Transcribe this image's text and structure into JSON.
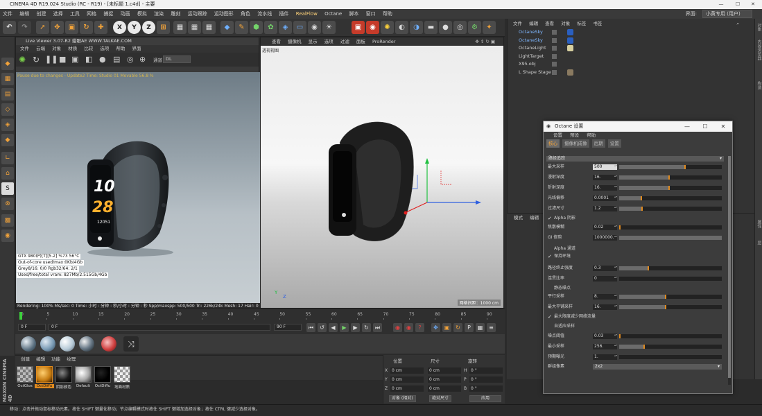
{
  "window": {
    "title": "CINEMA 4D R19.024 Studio (RC - R19) - [未标题 1.c4d] - 主要",
    "minimize": "—",
    "maximize": "☐",
    "close": "✕"
  },
  "menubar": {
    "items": [
      "文件",
      "编辑",
      "创建",
      "选择",
      "工具",
      "网格",
      "捕捉",
      "动画",
      "模拟",
      "渲染",
      "雕刻",
      "运动跟踪",
      "运动图形",
      "角色",
      "流水线",
      "插件",
      "RealFlow",
      "Octane",
      "脚本",
      "窗口",
      "帮助"
    ],
    "layout_label": "界面:",
    "layout_value": "小黄专用 (用户)"
  },
  "toolbar": {
    "undo": "↶",
    "xyz": [
      "X",
      "Y",
      "Z"
    ]
  },
  "live_viewer": {
    "title": "Live Viewer 3.07-R2 蜡眼AE WWW.TALKAE.COM",
    "menu": [
      "文件",
      "云端",
      "对象",
      "材质",
      "比较",
      "选项",
      "帮助",
      "界面"
    ],
    "channel_label": "通道",
    "channel_value": "DL",
    "warning": "Pause due to changes - Update2 Time: Studio 01 Movable 56.8 %",
    "watch_time_top": "10",
    "watch_time_bottom": "28",
    "watch_steps": "12051",
    "stats": [
      "GTX 980(P)[T][5.2]     %73    56°C",
      "Out-of-core used/max:0Kb/4Gb",
      "Grey8/16: 0/0        Rgb32/64: 2/1",
      "Used/free/total vram: 827Mb/2.515Gb/4Gb"
    ],
    "rendering": "Rendering: 100%   Ms/sec: 0   Time: 小时 : 分钟 : 秒/小时 : 分钟 : 秒   Spp/maxspp: 500/500     Tri: 226k/24k  Mesh: 17   Hair: 0",
    "progress": 1.0
  },
  "viewport": {
    "menu": [
      "查看",
      "摄像机",
      "显示",
      "选项",
      "过滤",
      "面板",
      "ProRender"
    ],
    "label": "透视视图",
    "corner": "网格间距：1000 cm",
    "axis_y": "Y",
    "axis_z": "Z"
  },
  "object_manager": {
    "menu": [
      "文件",
      "编辑",
      "查看",
      "对象",
      "标签",
      "书签"
    ],
    "objects": [
      {
        "name": "OctaneSky",
        "selected": true
      },
      {
        "name": "OctaneSky",
        "selected": true
      },
      {
        "name": "OctaneLight",
        "selected": false
      },
      {
        "name": "LightTarget",
        "selected": false
      },
      {
        "name": "X95.obj",
        "selected": false
      },
      {
        "name": "L Shape Stage",
        "selected": false
      }
    ]
  },
  "attributes": {
    "menu": [
      "模式",
      "编辑"
    ]
  },
  "right_strip": [
    "对象",
    "内容浏览器",
    "构造",
    "属性",
    "层"
  ],
  "octane_settings": {
    "title": "Octane 设置",
    "menu": [
      "设置",
      "预设",
      "帮助"
    ],
    "tabs": [
      "核心",
      "摄像机成像",
      "后期",
      "设置"
    ],
    "kernel": "路径追踪",
    "params": [
      {
        "label": "最大采样",
        "value": "500",
        "fill": 0.65
      },
      {
        "label": "漫射深度",
        "value": "16.",
        "fill": 0.49
      },
      {
        "label": "折射深度",
        "value": "16.",
        "fill": 0.49
      },
      {
        "label": "光线偏移",
        "value": "0.0001",
        "fill": 0.22
      },
      {
        "label": "过滤尺寸",
        "value": "1.2",
        "fill": 0.23
      }
    ],
    "alpha_shadow": "Alpha 阴影",
    "params2": [
      {
        "label": "焦散模糊",
        "value": "0.02",
        "fill": 0.01
      },
      {
        "label": "GI 修剪",
        "value": "1000000.",
        "fill": 1.0
      }
    ],
    "alpha_channel": "Alpha 通道",
    "keep_env": "保持环境",
    "params3": [
      {
        "label": "路径终止强度",
        "value": "0.3",
        "fill": 0.29
      },
      {
        "label": "连贯比率",
        "value": "0",
        "fill": 0.0
      }
    ],
    "static_noise": "静态噪点",
    "params4": [
      {
        "label": "平行采样",
        "value": "8.",
        "fill": 0.46
      },
      {
        "label": "最大平铺采样",
        "value": "16.",
        "fill": 0.46
      }
    ],
    "min_net": "最大限度减少网络流量",
    "adaptive": "自适应采样",
    "params5": [
      {
        "label": "噪点阈值",
        "value": "0.03",
        "fill": 0.01
      },
      {
        "label": "最小采样",
        "value": "256.",
        "fill": 0.25
      },
      {
        "label": "预期曝光",
        "value": "1.",
        "fill": 0.0
      }
    ],
    "group_pixels_label": "群组像素",
    "group_pixels": "2x2"
  },
  "timeline": {
    "ticks": [
      "0",
      "5",
      "10",
      "15",
      "20",
      "25",
      "30",
      "35",
      "40",
      "45",
      "50",
      "55",
      "60",
      "65",
      "70",
      "75",
      "80",
      "85",
      "90"
    ],
    "current_frame": "0 F",
    "start": "0 F",
    "end_a": "90 F",
    "end_b": "90 F",
    "end_label": "0 F"
  },
  "materials": {
    "menu": [
      "创建",
      "编辑",
      "功能",
      "纹理"
    ],
    "items": [
      "OctGlos",
      "OctDiffu",
      "阴影颜色",
      "Default",
      "OctDiffu",
      "地面材质"
    ]
  },
  "coordinates": {
    "headers": [
      "位置",
      "尺寸",
      "旋转"
    ],
    "rows": [
      {
        "axis": "X",
        "pos": "0 cm",
        "size": "0 cm",
        "rot_axis": "H",
        "rot": "0 °"
      },
      {
        "axis": "Y",
        "pos": "0 cm",
        "size": "0 cm",
        "rot_axis": "P",
        "rot": "0 °"
      },
      {
        "axis": "Z",
        "pos": "0 cm",
        "size": "0 cm",
        "rot_axis": "B",
        "rot": "0 °"
      }
    ],
    "mode_a": "对象 (相对)",
    "mode_b": "绝对尺寸",
    "apply": "应用"
  },
  "statusbar": {
    "text": "移动：点击并拖动鼠标移动元素。按住 SHIFT 键量化移动；节点编辑模式时按住 SHIFT 键增加选择对象；按住 CTRL 键减少选择对象。"
  },
  "brand": "MAXON CINEMA 4D",
  "colors": {
    "accent_orange": "#e08a1e",
    "axis_red": "#e02020",
    "axis_green": "#20c040",
    "axis_blue": "#3060e0",
    "progress_green": "#3cd23c"
  }
}
